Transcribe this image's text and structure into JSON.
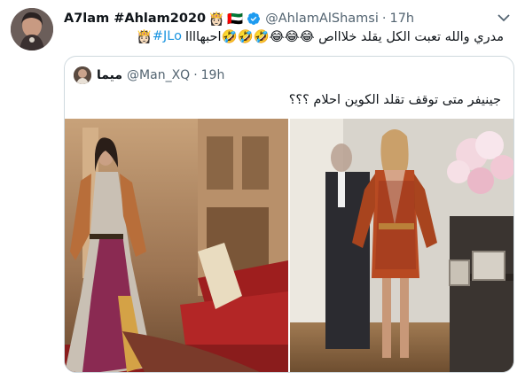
{
  "tweet": {
    "display_name": "A7lam #Ahlam2020",
    "handle": "@AhlamAlShamsi",
    "separator": "·",
    "time": "17h",
    "text": "مدري والله تعبت الكل يقلد خلاااص 😂😂😂🤣🤣🤣احبهاااا",
    "hashtag": "#JLo",
    "text_emoji_end": "👸🏻",
    "name_emojis": [
      "👸🏻",
      "🇦🇪"
    ]
  },
  "quoted": {
    "display_name": "ميما",
    "handle": "@Man_XQ",
    "separator": "·",
    "time": "19h",
    "text": "جينيفر متى توقف تقلد الكوين احلام ؟؟؟"
  },
  "colors": {
    "text": "#0f1419",
    "secondary": "#536471",
    "link": "#1b95e0",
    "verified": "#1d9bf0",
    "border": "#cfd9de"
  },
  "icons": {
    "verified": "verified-badge-icon",
    "more": "chevron-down-icon"
  }
}
